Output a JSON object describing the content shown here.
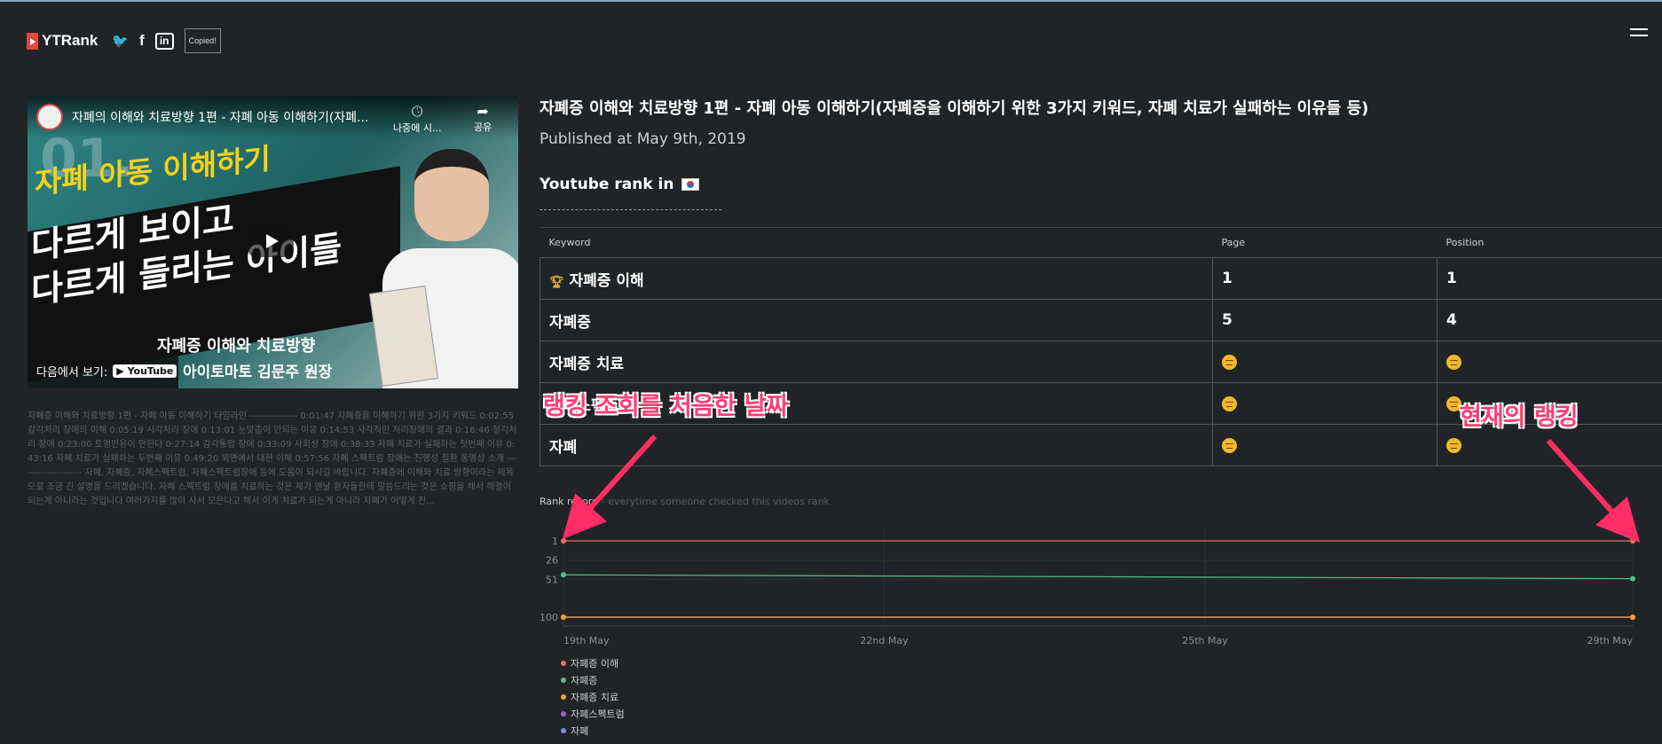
{
  "brand": {
    "name": "YTRank",
    "twitter_glyph": "🐦",
    "facebook_glyph": "f",
    "linkedin_glyph": "in",
    "copied_label": "Copied!"
  },
  "video": {
    "player_title": "자폐의 이해와 치료방향 1편 - 자폐 아동 이해하기(자폐...",
    "watch_later": "나중에 시...",
    "share": "공유",
    "banner_line_yellow": "자폐 아동 이해하기",
    "banner_line_1": "다르게 보이고",
    "banner_line_2": "다르게 들리는 아이들",
    "subtitle": "자폐증 이해와 치료방향",
    "presenter": "아이토마토 김문주 원장",
    "watch_on": "다음에서 보기:",
    "youtube": "▶ YouTube",
    "episode": "01."
  },
  "description": "자폐증 이해와 치료방향 1편 - 자폐 아동 이해하기 타임라인 --------------- 0:01:47 자폐증을 이해하기 위한 3가지 키워드 0:02:55 감각처리 장애의 이해 0:05:19 시각처리 장애 0:13:01 눈맞춤이 안되는 이유 0:14:53 사각적인 처리장애의 결과 0:16:46 청각처리 장애 0:23:00 토영반응이 안된다 0:27:14 감각통합 장애 0:33:09 사회성 장애 0:38:33 자폐 치료가 실패하는 첫번째 이유 0:43:16 자폐 치료가 실패하는 두번째 이유 0:49:20 외면에서 대한 이해 0:57:56 자폐 스펙트럼 장애는 진행성 질환 동영상 소개 -------------------- 자폐, 자폐증, 자폐스펙트럼, 자폐스펙트럼장애 등에 도움이 되시길 바랍니다. 자폐증에 이해와 치료 방향이라는 제목으로 조금 긴 설명을 드리겠습니다. 자폐 스펙트럼 장애를 치료하는 것은 제가 맨날 환자들한테 말씀드리는 것은 쇼핑을 해서 해결이 되는게 아니라는 것입니다 여러가지를 많이 사서 모은다고 해서 이게 치료가 되는게 아니라 자폐가 어떻게 진...",
  "title": "자폐증 이해와 치료방향 1편 - 자폐 아동 이해하기(자폐증을 이해하기 위한 3가지 키워드, 자폐 치료가 실패하는 이유들 등)",
  "published": "Published at May 9th, 2019",
  "rank_in": "Youtube rank in",
  "table": {
    "headers": [
      "Keyword",
      "Page",
      "Position"
    ],
    "rows": [
      {
        "keyword": "자폐증 이해",
        "page": "1",
        "position": "1",
        "top": true
      },
      {
        "keyword": "자폐증",
        "page": "5",
        "position": "4"
      },
      {
        "keyword": "자폐증 치료",
        "page": "",
        "position": ""
      },
      {
        "keyword": "자폐스펙트럼",
        "page": "",
        "position": ""
      },
      {
        "keyword": "자폐",
        "page": "",
        "position": ""
      }
    ]
  },
  "record": {
    "title": "Rank record",
    "subtitle": " - everytime someone checked this videos rank"
  },
  "annotations": {
    "left": "랭킹 조회를 처음한 날짜",
    "right": "현재의 랭킹"
  },
  "chart_data": {
    "type": "line",
    "x": [
      "19th May",
      "29th May"
    ],
    "x_ticks": [
      "19th May",
      "22nd May",
      "25th May",
      "29th May"
    ],
    "y_ticks": [
      "1",
      "26",
      "51",
      "100"
    ],
    "ylim": [
      1,
      100
    ],
    "y_inverted": true,
    "series": [
      {
        "name": "자폐증 이해",
        "color": "#f06a6a",
        "values": [
          1,
          1
        ]
      },
      {
        "name": "자폐증",
        "color": "#4fc38a",
        "values": [
          45,
          50
        ]
      },
      {
        "name": "자폐증 치료",
        "color": "#f0a030",
        "values": [
          100,
          100
        ]
      },
      {
        "name": "자폐스펙트럼",
        "color": "#9a5dc8",
        "values": [
          100,
          100
        ]
      },
      {
        "name": "자폐",
        "color": "#7f8fe6",
        "values": [
          100,
          100
        ]
      }
    ]
  }
}
